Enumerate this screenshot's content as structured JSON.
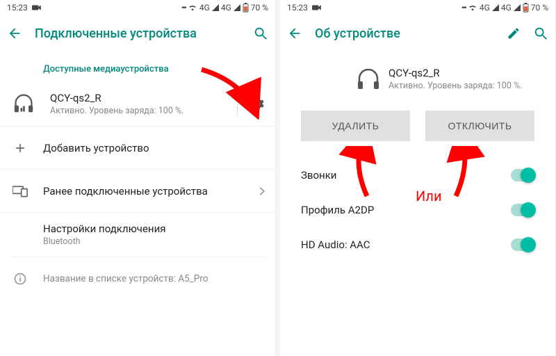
{
  "status": {
    "time": "15:23",
    "signal_label": "4G",
    "battery_pct": "70 %"
  },
  "left": {
    "title": "Подключенные устройства",
    "section_available": "Доступные медиаустройства",
    "device": {
      "name": "QCY-qs2_R",
      "status": "Активно. Уровень заряда: 100 %."
    },
    "add_device": "Добавить устройство",
    "previous": "Ранее подключенные устройства",
    "conn_pref": {
      "primary": "Настройки подключения",
      "secondary": "Bluetooth"
    },
    "device_name_row": {
      "label": "Название в списке устройств:",
      "value": "A5_Pro"
    }
  },
  "right": {
    "title": "Об устройстве",
    "device": {
      "name": "QCY-qs2_R",
      "status": "Активно. Уровень заряда: 100 %."
    },
    "btn_delete": "УДАЛИТЬ",
    "btn_disconnect": "ОТКЛЮЧИТЬ",
    "calls": "Звонки",
    "a2dp": "Профиль A2DP",
    "hd_audio": "HD Audio: AAC",
    "or_text": "Или"
  }
}
